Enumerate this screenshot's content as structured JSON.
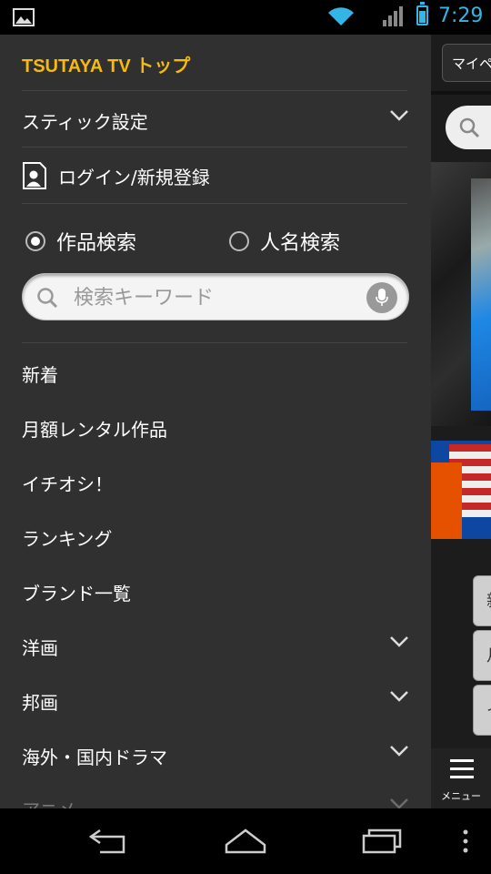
{
  "statusbar": {
    "time": "7:29",
    "icons": [
      "image-icon",
      "wifi-icon",
      "signal-icon",
      "battery-icon"
    ]
  },
  "drawer": {
    "title": "TSUTAYA TV トップ",
    "stick_settings": "スティック設定",
    "login": "ログイン/新規登録",
    "search_modes": {
      "title_search": "作品検索",
      "person_search": "人名検索",
      "selected": "作品検索"
    },
    "search": {
      "placeholder": "検索キーワード"
    },
    "menu": [
      {
        "label": "新着",
        "expandable": false
      },
      {
        "label": "月額レンタル作品",
        "expandable": false
      },
      {
        "label": "イチオシ！",
        "expandable": false
      },
      {
        "label": "ランキング",
        "expandable": false
      },
      {
        "label": "ブランド一覧",
        "expandable": false
      },
      {
        "label": "洋画",
        "expandable": true
      },
      {
        "label": "邦画",
        "expandable": true
      },
      {
        "label": "海外・国内ドラマ",
        "expandable": true
      },
      {
        "label": "アニメ",
        "expandable": true
      }
    ]
  },
  "background_app": {
    "mypage_label": "マイペ",
    "side_tabs": [
      "新",
      "月",
      "イ"
    ],
    "menu_label": "メニュー"
  },
  "colors": {
    "accent": "#f5b90f",
    "drawer_bg": "#303030",
    "status_blue": "#33b5e5"
  }
}
